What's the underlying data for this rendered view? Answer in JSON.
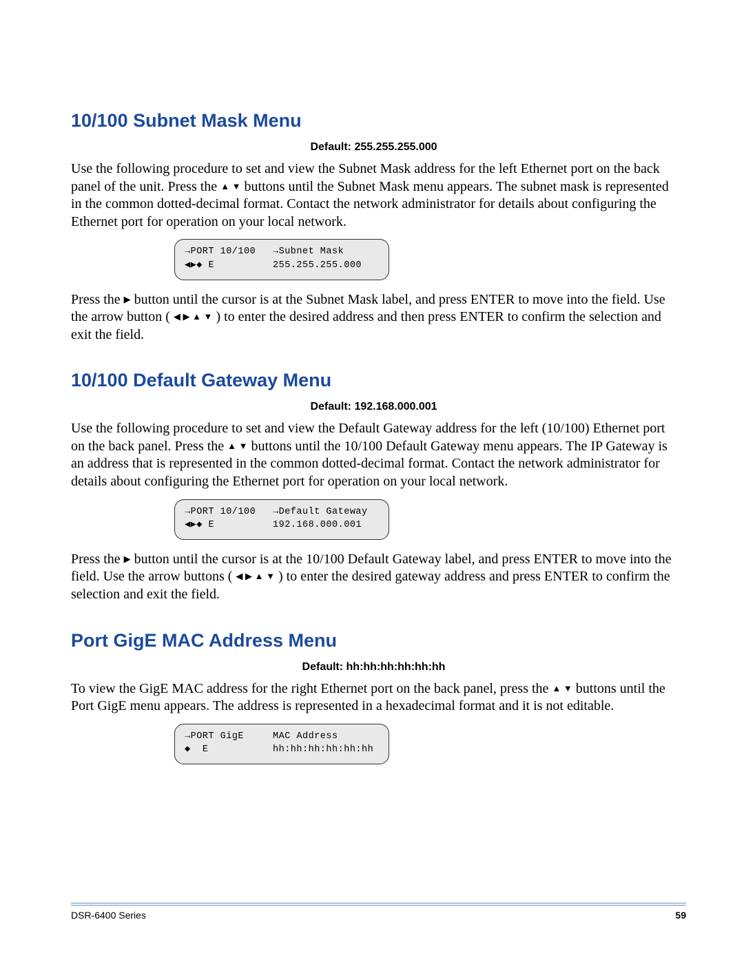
{
  "sections": {
    "subnet": {
      "heading": "10/100 Subnet Mask Menu",
      "default_label": "Default: 255.255.255.000",
      "para1a": "Use the following procedure to set and view the Subnet Mask address for the left Ethernet port on the back panel of the unit. Press the ",
      "para1b": " buttons until the Subnet Mask menu appears. The subnet mask is represented in the common dotted-decimal format. Contact the network administrator for details about configuring the Ethernet port for operation on your local network.",
      "lcd": {
        "row1_col1": "→PORT 10/100",
        "row1_col2": "→Subnet Mask",
        "row2_col1": "◀▶◆ E",
        "row2_col2": "255.255.255.000"
      },
      "para2a": "Press the ",
      "para2b": " button until the cursor is at the Subnet Mask label, and press ENTER to move into the field. Use the arrow button ( ",
      "para2c": " ) to enter the desired address and then press ENTER to confirm the selection and exit the field."
    },
    "gateway": {
      "heading": "10/100 Default Gateway Menu",
      "default_label": "Default: 192.168.000.001",
      "para1a": "Use the following procedure to set and view the Default Gateway address for the left (10/100) Ethernet port on the back panel. Press the ",
      "para1b": " buttons until the 10/100 Default Gateway menu appears. The IP Gateway is an address that is represented in the common dotted-decimal format. Contact the network administrator for details about configuring the Ethernet port for operation on your local network.",
      "lcd": {
        "row1_col1": "→PORT 10/100",
        "row1_col2": "→Default Gateway",
        "row2_col1": "◀▶◆ E",
        "row2_col2": "192.168.000.001"
      },
      "para2a": "Press the ",
      "para2b": " button until the cursor is at the 10/100 Default Gateway label, and press ENTER to move into the field. Use the arrow buttons ( ",
      "para2c": " ) to enter the desired gateway address and press ENTER to confirm the selection and exit the field."
    },
    "gige": {
      "heading": "Port GigE MAC Address Menu",
      "default_label": "Default: hh:hh:hh:hh:hh:hh",
      "para1a": "To view the GigE MAC address for the right Ethernet port on the back panel, press the ",
      "para1b": " buttons until the Port GigE menu appears. The address is represented in a hexadecimal format and it is not editable.",
      "lcd": {
        "row1_col1": "→PORT GigE",
        "row1_col2": "MAC Address",
        "row2_col1": "◆  E",
        "row2_col2": "hh:hh:hh:hh:hh:hh"
      }
    }
  },
  "icons": {
    "updown": "▲ ▼",
    "right": "▶",
    "all4": "◀  ▶  ▲  ▼"
  },
  "footer": {
    "series": "DSR-6400 Series",
    "page": "59"
  }
}
